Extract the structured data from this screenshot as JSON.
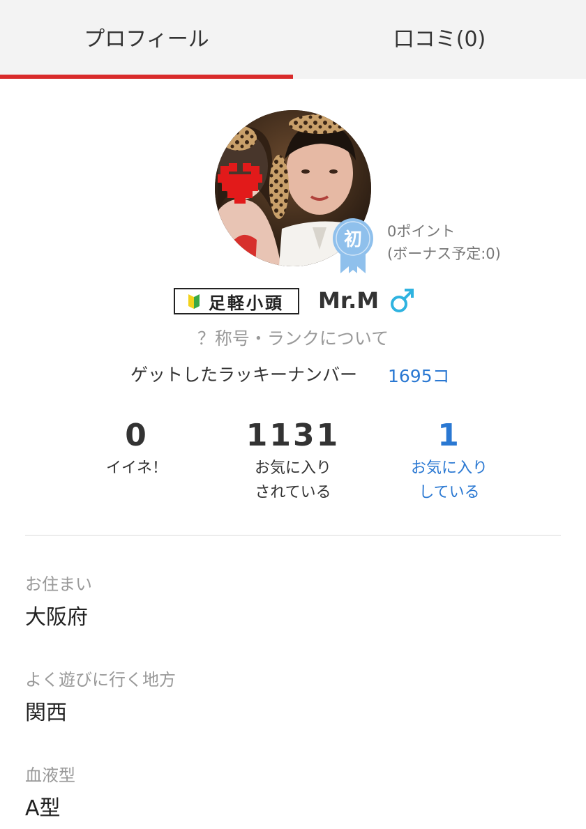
{
  "tabs": [
    {
      "label": "プロフィール",
      "active": true
    },
    {
      "label": "口コミ(0)",
      "active": false
    }
  ],
  "profile": {
    "badge_char": "初",
    "points": "0ポイント",
    "bonus": "(ボーナス予定:0)",
    "rank": "足軽小頭",
    "username": "Mr.M",
    "rank_link": "？称号・ランクについて",
    "lucky_label": "ゲットしたラッキーナンバー",
    "lucky_value": "1695コ"
  },
  "stats": [
    {
      "value": "0",
      "label": "イイネ！"
    },
    {
      "value": "1131",
      "label": "お気に入り\nされている"
    },
    {
      "value": "1",
      "label": "お気に入り\nしている"
    }
  ],
  "details": [
    {
      "label": "お住まい",
      "value": "大阪府"
    },
    {
      "label": "よく遊びに行く地方",
      "value": "関西"
    },
    {
      "label": "血液型",
      "value": "A型"
    }
  ],
  "colors": {
    "accent_red": "#d92b2b",
    "link_blue": "#2a78d2",
    "badge_blue": "#8fc0ec",
    "gender_cyan": "#2fb3e0",
    "beginner_green": "#3aa845",
    "beginner_yellow": "#f2d21b"
  },
  "icons": [
    "beginner-mark-icon",
    "male-gender-icon",
    "ribbon-badge-icon"
  ]
}
